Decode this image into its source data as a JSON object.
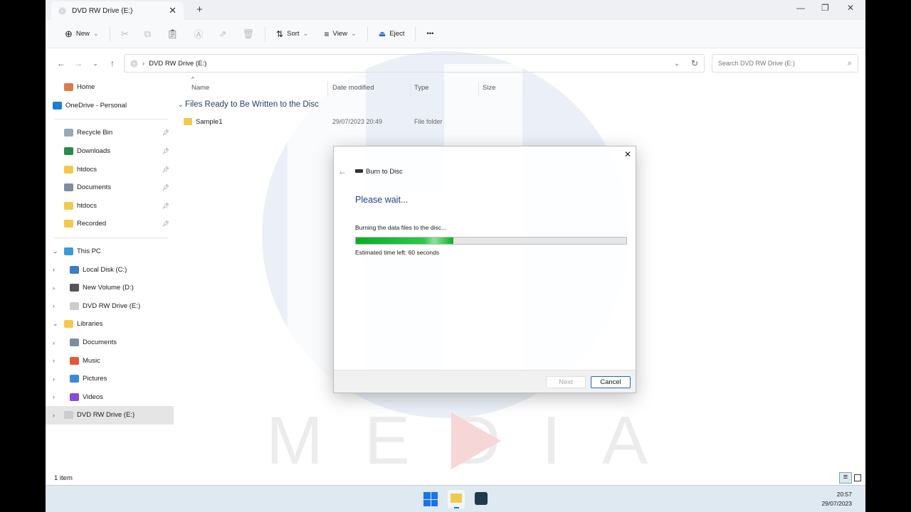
{
  "window": {
    "tab_title": "DVD RW Drive (E:)",
    "new_tab": "+",
    "minimize": "—",
    "restore": "❐",
    "close": "✕"
  },
  "toolbar": {
    "new": "New",
    "sort": "Sort",
    "view": "View",
    "eject": "Eject",
    "more": "•••"
  },
  "address": {
    "path": "DVD RW Drive (E:)",
    "search_placeholder": "Search DVD RW Drive (E:)"
  },
  "sidebar": {
    "items": [
      {
        "label": "Home",
        "color": "#d97b4a"
      },
      {
        "label": "OneDrive - Personal",
        "color": "#1b7fd8"
      },
      {
        "label": "Recycle Bin",
        "color": "#9aa9b8",
        "pin": true
      },
      {
        "label": "Downloads",
        "color": "#2a8a4a",
        "pin": true
      },
      {
        "label": "htdocs",
        "color": "#f2c94c",
        "pin": true
      },
      {
        "label": "Documents",
        "color": "#7c8da0",
        "pin": true
      },
      {
        "label": "htdocs",
        "color": "#f2c94c",
        "pin": true
      },
      {
        "label": "Recorded",
        "color": "#f2c94c",
        "pin": true
      },
      {
        "label": "This PC",
        "color": "#3a9ad9"
      },
      {
        "label": "Local Disk (C:)",
        "color": "#3a7fc0"
      },
      {
        "label": "New Volume (D:)",
        "color": "#555"
      },
      {
        "label": "DVD RW Drive (E:)",
        "color": "#ccc"
      },
      {
        "label": "Libraries",
        "color": "#f2c94c"
      },
      {
        "label": "Documents",
        "color": "#7c8da0"
      },
      {
        "label": "Music",
        "color": "#e05a3a"
      },
      {
        "label": "Pictures",
        "color": "#3a8ad9"
      },
      {
        "label": "Videos",
        "color": "#8a4ad9"
      },
      {
        "label": "DVD RW Drive (E:)",
        "color": "#ccc"
      }
    ]
  },
  "columns": {
    "name": "Name",
    "date": "Date modified",
    "type": "Type",
    "size": "Size"
  },
  "group": "Files Ready to Be Written to the Disc",
  "files": [
    {
      "name": "Sample1",
      "date": "29/07/2023 20:49",
      "type": "File folder"
    }
  ],
  "status": "1 item",
  "dialog": {
    "title": "Burn to Disc",
    "heading": "Please wait...",
    "message": "Burning the data files to the disc...",
    "progress_percent": 36,
    "time_left": "Estimated time left: 60 seconds",
    "next": "Next",
    "cancel": "Cancel",
    "close": "✕"
  },
  "taskbar": {
    "time": "20:57",
    "date": "29/07/2023"
  },
  "watermark": {
    "text": "MEDIA",
    "letter": "H"
  },
  "colors": {
    "accent": "#1f4e9a",
    "progress": "#06b025"
  }
}
